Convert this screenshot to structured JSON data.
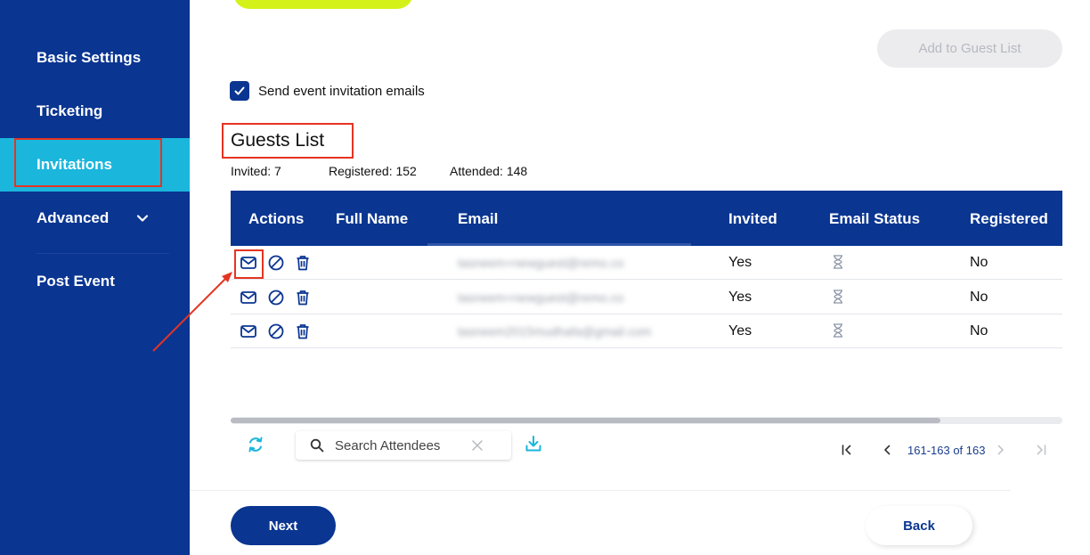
{
  "sidebar": {
    "items": [
      {
        "label": "Basic Settings"
      },
      {
        "label": "Ticketing"
      },
      {
        "label": "Invitations",
        "active": true
      },
      {
        "label": "Advanced",
        "icon": "chevron-down-icon"
      },
      {
        "label": "Post Event"
      }
    ]
  },
  "toolbar": {
    "add_to_guest_list": "Add to Guest List"
  },
  "invite_option": {
    "label": "Send event invitation emails",
    "checked": true
  },
  "guests": {
    "title": "Guests List",
    "stats": {
      "invited": "Invited: 7",
      "registered": "Registered: 152",
      "attended": "Attended: 148"
    },
    "columns": [
      "Actions",
      "Full Name",
      "Email",
      "Invited",
      "Email Status",
      "Registered"
    ],
    "rows": [
      {
        "full_name": "",
        "email": "tasneem+newguest@remo.co",
        "invited": "Yes",
        "email_status_icon": "hourglass-icon",
        "registered": "No"
      },
      {
        "full_name": "",
        "email": "tasneem+newguest@remo.co",
        "invited": "Yes",
        "email_status_icon": "hourglass-icon",
        "registered": "No"
      },
      {
        "full_name": "",
        "email": "tasneem2015mudhafa@gmail.com",
        "invited": "Yes",
        "email_status_icon": "hourglass-icon",
        "registered": "No"
      }
    ],
    "row_actions": [
      "mail-icon",
      "block-icon",
      "trash-icon"
    ]
  },
  "footer": {
    "search_placeholder": "Search Attendees",
    "pagination": "161-163 of 163"
  },
  "buttons": {
    "next": "Next",
    "back": "Back"
  },
  "colors": {
    "primary": "#0a3591",
    "active_nav": "#1bb6dc",
    "accent_lime": "#d4f21a",
    "annotation": "#e53422"
  }
}
